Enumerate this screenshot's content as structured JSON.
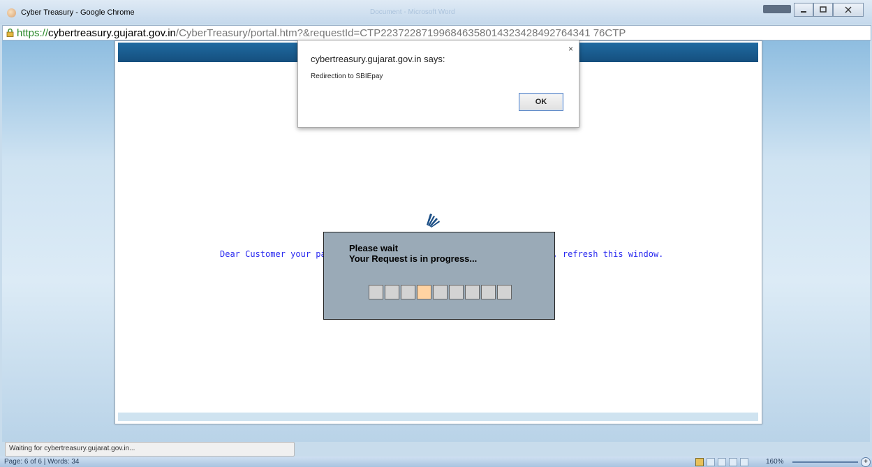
{
  "window": {
    "title": "Cyber Treasury - Google Chrome",
    "background_title": "Document - Microsoft Word"
  },
  "address_bar": {
    "protocol": "https://",
    "host": "cybertreasury.gujarat.gov.in",
    "path": "/CyberTreasury/portal.htm?&requestId=CTP223722871996846358014323428492764341 76CTP"
  },
  "page": {
    "message_start": "Dear Customer your pay",
    "message_end": "e , refresh this window."
  },
  "progress": {
    "title": "Please wait",
    "subtitle": "Your Request is in progress...",
    "cells": 9,
    "active_cell": 4
  },
  "alert": {
    "title": "cybertreasury.gujarat.gov.in says:",
    "message": "Redirection to SBIEpay",
    "ok_label": "OK",
    "close_label": "×"
  },
  "status": {
    "text": "Waiting for cybertreasury.gujarat.gov.in..."
  },
  "word_status": {
    "page_info": "Page: 6 of 6",
    "words_info": "Words: 34",
    "zoom": "160%"
  },
  "colors": {
    "header_blue": "#1f6aa1",
    "link_blue": "#2b2bf0",
    "progress_active": "#ffd3a2"
  }
}
